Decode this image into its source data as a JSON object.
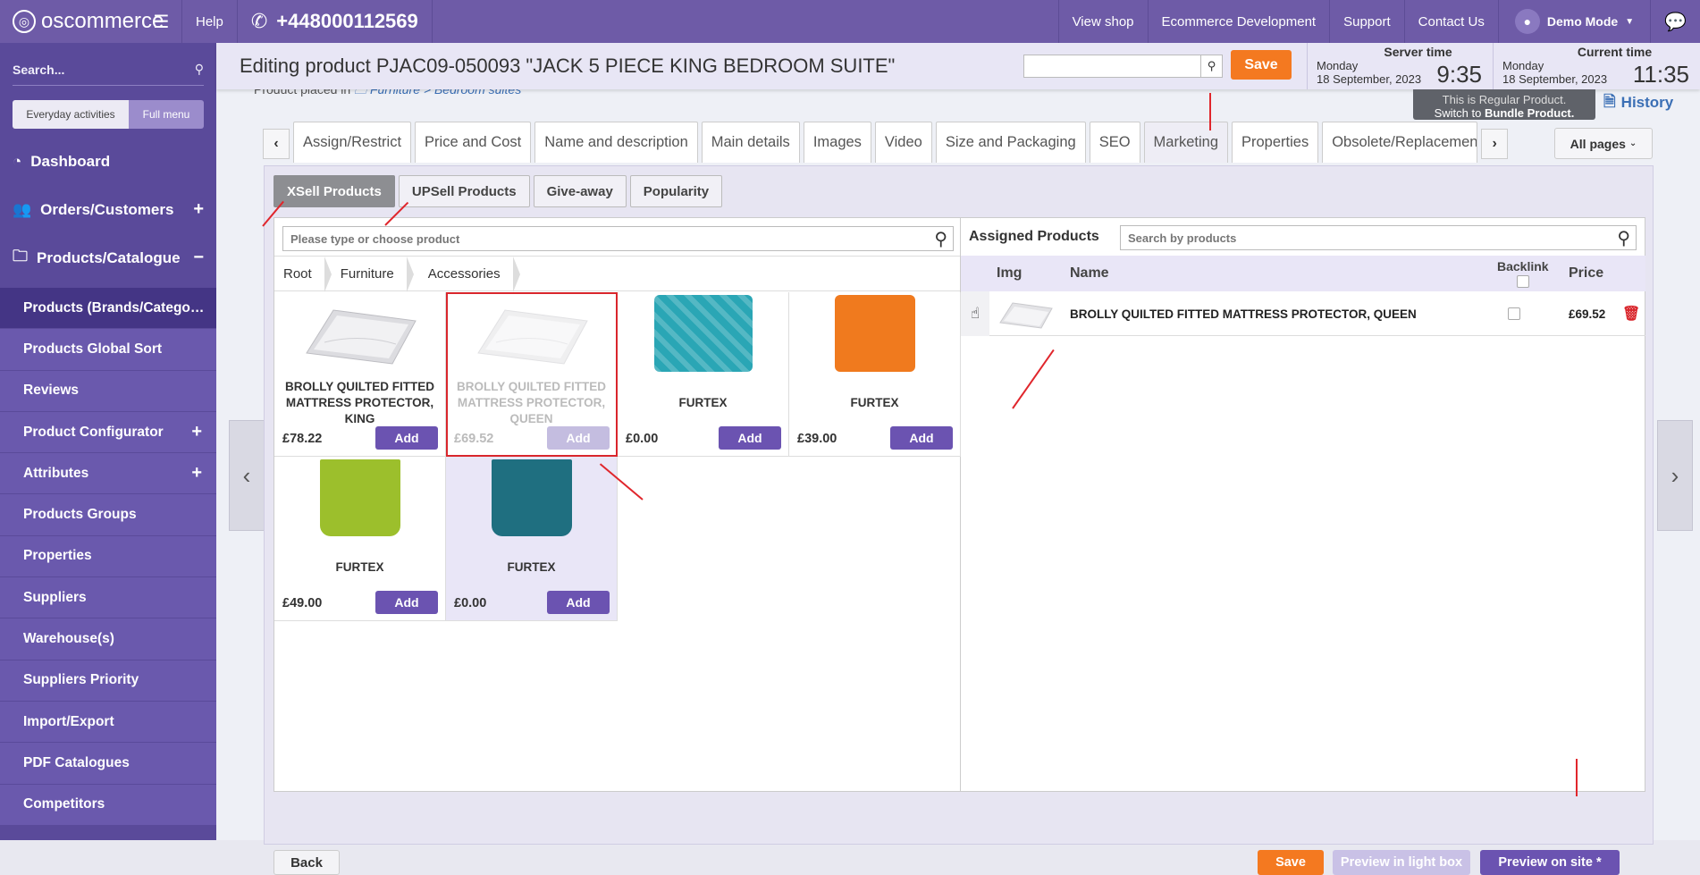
{
  "topbar": {
    "logo": "oscommerce",
    "help": "Help",
    "phone": "+448000112569",
    "view_shop": "View shop",
    "ecommerce_dev": "Ecommerce Development",
    "support": "Support",
    "contact": "Contact Us",
    "user": "Demo Mode"
  },
  "sidebar": {
    "search_placeholder": "Search...",
    "tab_everyday": "Everyday activities",
    "tab_full": "Full menu",
    "items": [
      {
        "label": "Dashboard"
      },
      {
        "label": "Orders/Customers"
      },
      {
        "label": "Products/Catalogue"
      }
    ],
    "sub": [
      {
        "label": "Products (Brands/Catego…"
      },
      {
        "label": "Products Global Sort"
      },
      {
        "label": "Reviews"
      },
      {
        "label": "Product Configurator"
      },
      {
        "label": "Attributes"
      },
      {
        "label": "Products Groups"
      },
      {
        "label": "Properties"
      },
      {
        "label": "Suppliers"
      },
      {
        "label": "Warehouse(s)"
      },
      {
        "label": "Suppliers Priority"
      },
      {
        "label": "Import/Export"
      },
      {
        "label": "PDF Catalogues"
      },
      {
        "label": "Competitors"
      }
    ]
  },
  "header": {
    "title": "Editing product PJAC09-050093 \"JACK 5 PIECE KING BEDROOM SUITE\"",
    "save": "Save",
    "server_time_label": "Server time",
    "server_day": "Monday",
    "server_date": "18 September, 2023",
    "server_time": "9:35",
    "current_time_label": "Current time",
    "current_day": "Monday",
    "current_date": "18 September, 2023",
    "current_time": "11:35"
  },
  "crumb": {
    "prefix": "Product placed in",
    "path": "Furniture > Bedroom suites"
  },
  "bundle": {
    "line1": "This is Regular Product.",
    "line2_prefix": "Switch to",
    "line2_link": "Bundle Product."
  },
  "history": "History",
  "tabs": [
    "Assign/Restrict",
    "Price and Cost",
    "Name and description",
    "Main details",
    "Images",
    "Video",
    "Size and Packaging",
    "SEO",
    "Marketing",
    "Properties",
    "Obsolete/Replacement"
  ],
  "all_pages": "All pages",
  "subtabs": [
    "XSell Products",
    "UPSell Products",
    "Give-away",
    "Popularity"
  ],
  "left": {
    "search_placeholder": "Please type or choose product",
    "breadcrumb": [
      "Root",
      "Furniture",
      "Accessories"
    ],
    "products": [
      {
        "name": "BROLLY QUILTED FITTED MATTRESS PROTECTOR, KING",
        "price": "£78.22",
        "add": "Add",
        "color": "#e8e8ea"
      },
      {
        "name": "BROLLY QUILTED FITTED MATTRESS PROTECTOR, QUEEN",
        "price": "£69.52",
        "add": "Add",
        "color": "#e8e8ea"
      },
      {
        "name": "FURTEX",
        "price": "£0.00",
        "add": "Add",
        "color": "#2aa6b5"
      },
      {
        "name": "FURTEX",
        "price": "£39.00",
        "add": "Add",
        "color": "#f07a1e"
      },
      {
        "name": "FURTEX",
        "price": "£49.00",
        "add": "Add",
        "color": "#9cbf2c"
      },
      {
        "name": "FURTEX",
        "price": "£0.00",
        "add": "Add",
        "color": "#1f6f80"
      }
    ]
  },
  "right": {
    "title": "Assigned Products",
    "search_placeholder": "Search by products",
    "col_img": "Img",
    "col_name": "Name",
    "col_backlink": "Backlink",
    "col_price": "Price",
    "row_name": "BROLLY QUILTED FITTED MATTRESS PROTECTOR, QUEEN",
    "row_price": "£69.52"
  },
  "footer": {
    "back": "Back",
    "save": "Save",
    "preview_lightbox": "Preview in light box",
    "preview_site": "Preview on site *"
  }
}
